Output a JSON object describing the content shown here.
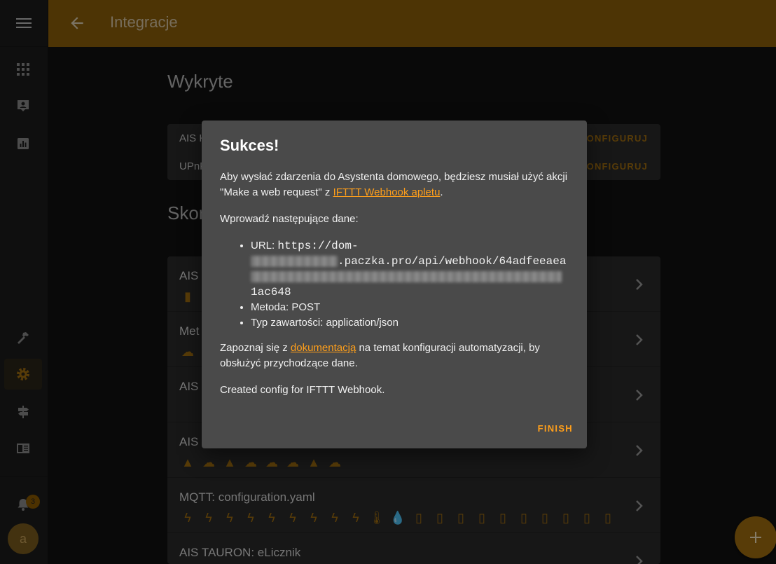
{
  "header": {
    "title": "Integracje"
  },
  "sidebar": {
    "notifications_count": "3",
    "avatar_letter": "a"
  },
  "discovered": {
    "title": "Wykryte",
    "items": [
      {
        "name": "AIS K",
        "action": "KONFIGURUJ"
      },
      {
        "name": "UPnP",
        "action": "KONFIGURUJ"
      }
    ]
  },
  "configured": {
    "title": "Skon",
    "items": [
      {
        "name": "AIS"
      },
      {
        "name": "Met"
      },
      {
        "name": "AIS"
      },
      {
        "name": "AIS"
      },
      {
        "name": "MQTT: configuration.yaml"
      },
      {
        "name": "AIS TAURON: eLicznik"
      }
    ]
  },
  "dialog": {
    "title": "Sukces!",
    "p1_before": "Aby wysłać zdarzenia do Asystenta domowego, będziesz musiał użyć akcji \"Make a web request\" z ",
    "p1_link": "IFTTT Webhook apletu",
    "p1_after": ".",
    "p2": "Wprowadź następujące dane:",
    "url_label": "URL: ",
    "url_part1": "https://dom-",
    "url_part2": ".paczka.pro/api/webhook/64adfeeaea",
    "url_part3": "1ac648",
    "method": "Metoda: POST",
    "content_type": "Typ zawartości: application/json",
    "p3_before": "Zapoznaj się z ",
    "p3_link": "dokumentacją",
    "p3_after": " na temat konfiguracji automatyzacji, by obsłużyć przychodzące dane.",
    "p4": "Created config for IFTTT Webhook.",
    "finish": "FINISH"
  },
  "colors": {
    "accent": "#ff9f1a",
    "header": "#8c5f0a",
    "dialog": "#4a4a4a"
  }
}
